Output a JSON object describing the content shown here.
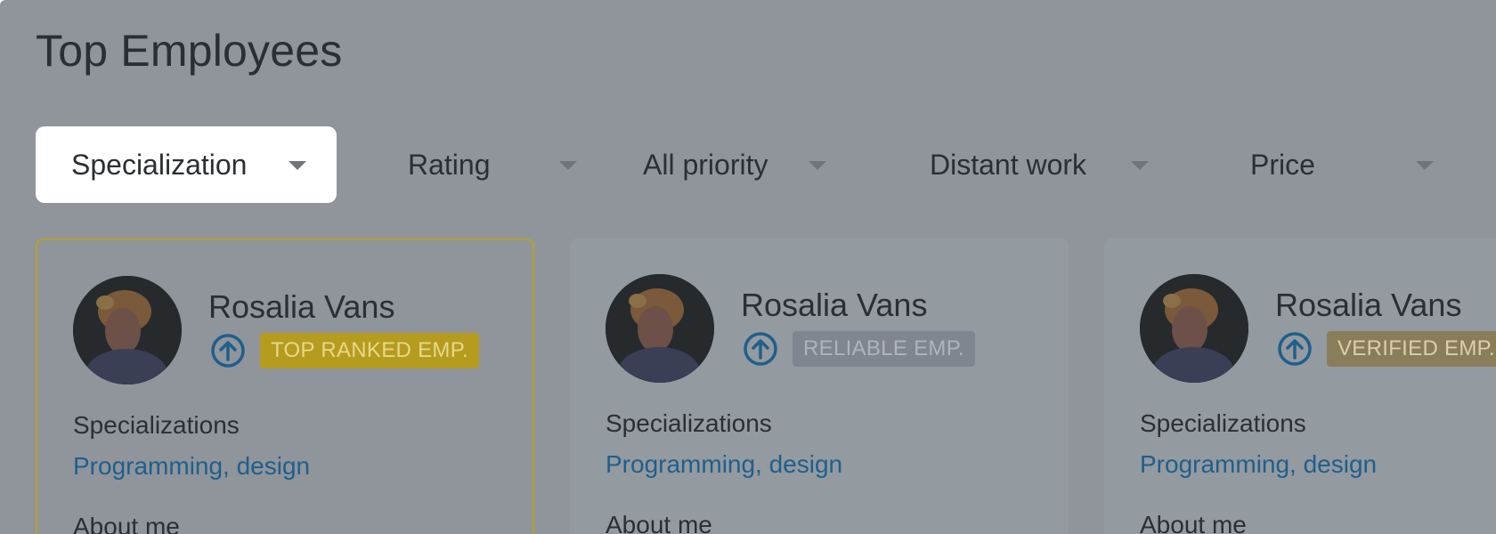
{
  "page": {
    "title": "Top Employees"
  },
  "filters": [
    {
      "label": "Specialization"
    },
    {
      "label": "Rating"
    },
    {
      "label": "All priority"
    },
    {
      "label": "Distant work"
    },
    {
      "label": "Price"
    }
  ],
  "cards": [
    {
      "name": "Rosalia Vans",
      "badge": "TOP RANKED EMP.",
      "badge_bg": "#b69c1e",
      "badge_color": "#e6d88a",
      "specializations_label": "Specializations",
      "specializations_value": "Programming, design",
      "about_label": "About me"
    },
    {
      "name": "Rosalia Vans",
      "badge": "RELIABLE EMP.",
      "badge_bg": "#7f8690",
      "badge_color": "#aeb4bb",
      "specializations_label": "Specializations",
      "specializations_value": "Programming, design",
      "about_label": "About me"
    },
    {
      "name": "Rosalia Vans",
      "badge": "VERIFIED EMP.",
      "badge_bg": "#8a7d5a",
      "badge_color": "#d9ceb0",
      "specializations_label": "Specializations",
      "specializations_value": "Programming, design",
      "about_label": "About me"
    }
  ],
  "colors": {
    "overlay": "#8f959b",
    "link": "#1f5f8b",
    "featured_border": "#b6a12a",
    "rank_icon": "#1f5f8b"
  },
  "icons": {
    "rank": "arrow-up-circle-icon",
    "dropdown": "chevron-down-icon"
  }
}
